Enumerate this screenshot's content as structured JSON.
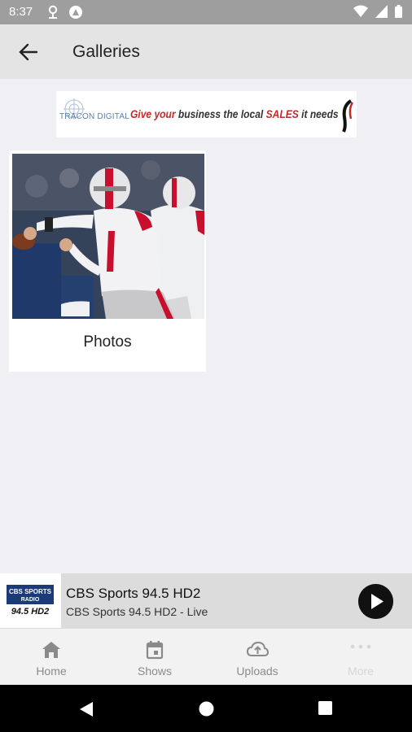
{
  "status_bar": {
    "time": "8:37"
  },
  "app_bar": {
    "title": "Galleries"
  },
  "ad": {
    "logo_text": "TRACON DIGITAL",
    "text_give": "Give",
    "text_your": "your",
    "text_mid": "business the local",
    "text_sales": "SALES",
    "text_end": "it needs"
  },
  "galleries": [
    {
      "label": "Photos"
    }
  ],
  "player": {
    "station_name": "CBS Sports 94.5 HD2",
    "station_status": "CBS Sports 94.5 HD2 - Live",
    "logo_line1": "CBS SPORTS",
    "logo_line2": "RADIO",
    "logo_freq": "94.5 HD2"
  },
  "bottom_nav": {
    "items": [
      {
        "label": "Home",
        "icon": "home-icon"
      },
      {
        "label": "Shows",
        "icon": "calendar-icon"
      },
      {
        "label": "Uploads",
        "icon": "cloud-upload-icon"
      },
      {
        "label": "More",
        "icon": "more-dots-icon"
      }
    ]
  },
  "colors": {
    "app_bar": "#e4e4e4",
    "background": "#efeff4",
    "status_bar": "#9e9e9e",
    "ad_red": "#c62828"
  }
}
